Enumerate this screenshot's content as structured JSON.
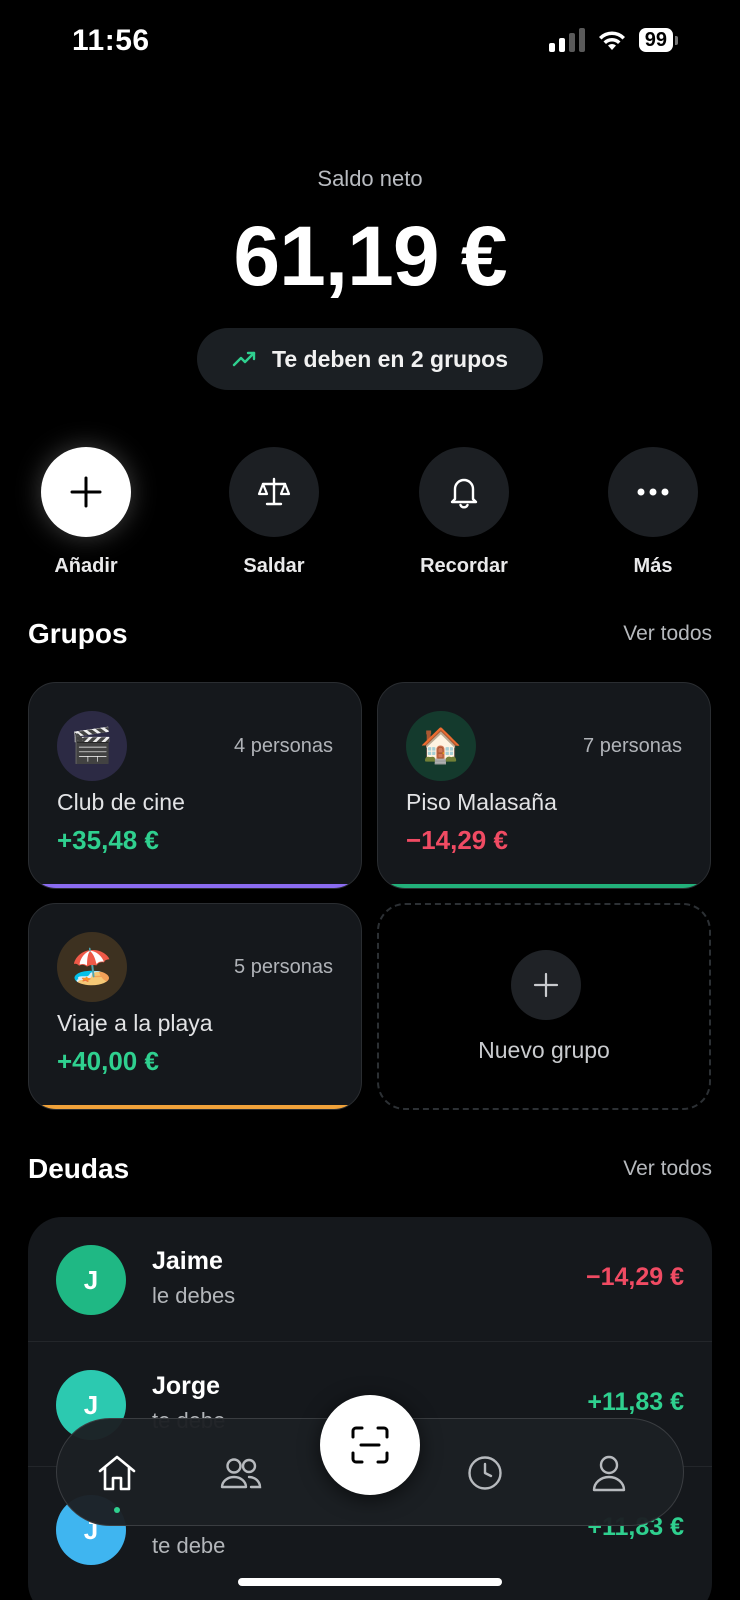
{
  "status": {
    "time": "11:56",
    "battery": "99"
  },
  "header": {
    "label": "Saldo neto",
    "amount": "61,19 €",
    "pill_text": "Te deben en 2 grupos"
  },
  "actions": [
    {
      "label": "Añadir",
      "icon": "plus-icon"
    },
    {
      "label": "Saldar",
      "icon": "scale-icon"
    },
    {
      "label": "Recordar",
      "icon": "bell-icon"
    },
    {
      "label": "Más",
      "icon": "more-icon"
    }
  ],
  "groups": {
    "title": "Grupos",
    "see_all": "Ver todos",
    "items": [
      {
        "emoji": "🎬",
        "people": "4 personas",
        "name": "Club de cine",
        "balance": "+35,48 €",
        "accent": "#8b6cf0",
        "emoji_bg": "#2c2a44"
      },
      {
        "emoji": "🏠",
        "people": "7 personas",
        "name": "Piso Malasaña",
        "balance": "−14,29 €",
        "accent": "#22b07a",
        "emoji_bg": "#143a2d"
      },
      {
        "emoji": "🏖️",
        "people": "5 personas",
        "name": "Viaje a la playa",
        "balance": "+40,00 €",
        "accent": "#f0a23a",
        "emoji_bg": "#3d3120"
      }
    ],
    "new_group": "Nuevo grupo"
  },
  "debts": {
    "title": "Deudas",
    "see_all": "Ver todos",
    "items": [
      {
        "initial": "J",
        "name": "Jaime",
        "sub": "le debes",
        "amount": "−14,29 €",
        "color": "#1fb884"
      },
      {
        "initial": "J",
        "name": "Jorge",
        "sub": "te debe",
        "amount": "+11,83 €",
        "color": "#2cc9b0"
      },
      {
        "initial": "J",
        "name": "",
        "sub": "te debe",
        "amount": "+11,83 €",
        "color": "#3fb5f0"
      }
    ]
  },
  "tabs": [
    {
      "name": "home",
      "icon": "home-icon"
    },
    {
      "name": "friends",
      "icon": "people-icon"
    },
    {
      "name": "scan",
      "icon": "scan-icon"
    },
    {
      "name": "activity",
      "icon": "clock-icon"
    },
    {
      "name": "profile",
      "icon": "person-icon"
    }
  ],
  "colors": {
    "positive": "#2fd08f",
    "negative": "#f04b63",
    "background": "#000000",
    "card": "#15181c"
  }
}
